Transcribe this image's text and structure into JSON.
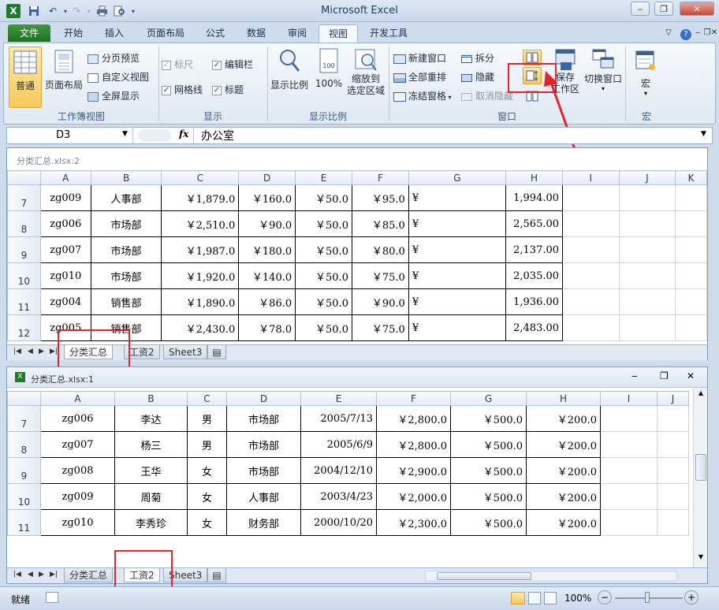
{
  "app": {
    "title": "Microsoft Excel",
    "qat_icons": [
      "excel-logo-icon",
      "save-icon",
      "undo-icon",
      "redo-icon",
      "print-icon",
      "print-preview-icon",
      "customize-icon"
    ]
  },
  "ribbon_tabs": [
    "文件",
    "开始",
    "插入",
    "页面布局",
    "公式",
    "数据",
    "审阅",
    "视图",
    "开发工具"
  ],
  "active_tab": "视图",
  "ribbon": {
    "workbook_views": {
      "label": "工作簿视图",
      "normal": "普通",
      "page_layout": "页面布局",
      "page_break": "分页预览",
      "custom_views": "自定义视图",
      "full_screen": "全屏显示"
    },
    "show": {
      "label": "显示",
      "ruler": "标尺",
      "formula_bar": "编辑栏",
      "gridlines": "网格线",
      "headings": "标题"
    },
    "zoom": {
      "label": "显示比例",
      "zoom": "显示比例",
      "hundred": "100%",
      "zoom_selection_1": "缩放到",
      "zoom_selection_2": "选定区域"
    },
    "window": {
      "label": "窗口",
      "new_window": "新建窗口",
      "arrange_all": "全部重排",
      "freeze": "冻结窗格",
      "split": "拆分",
      "hide": "隐藏",
      "unhide": "取消隐藏",
      "save_workspace_1": "保存",
      "save_workspace_2": "工作区",
      "switch_windows": "切换窗口"
    },
    "macros": {
      "label": "宏",
      "macros": "宏"
    }
  },
  "formula_bar": {
    "name_box": "D3",
    "fx": "fx",
    "value": "办公室"
  },
  "window2": {
    "title": "分类汇总.xlsx:2",
    "columns": [
      "A",
      "B",
      "C",
      "D",
      "E",
      "F",
      "G",
      "H",
      "I",
      "J",
      "K"
    ],
    "rows": [
      {
        "n": "7",
        "cells": [
          "zg009",
          "人事部",
          "￥1,879.0",
          "￥160.0",
          "￥50.0",
          "￥95.0",
          "¥",
          "1,994.00"
        ]
      },
      {
        "n": "8",
        "cells": [
          "zg006",
          "市场部",
          "￥2,510.0",
          "￥90.0",
          "￥50.0",
          "￥85.0",
          "¥",
          "2,565.00"
        ]
      },
      {
        "n": "9",
        "cells": [
          "zg007",
          "市场部",
          "￥1,987.0",
          "￥180.0",
          "￥50.0",
          "￥80.0",
          "¥",
          "2,137.00"
        ]
      },
      {
        "n": "10",
        "cells": [
          "zg010",
          "市场部",
          "￥1,920.0",
          "￥140.0",
          "￥50.0",
          "￥75.0",
          "¥",
          "2,035.00"
        ]
      },
      {
        "n": "11",
        "cells": [
          "zg004",
          "销售部",
          "￥1,890.0",
          "￥86.0",
          "￥50.0",
          "￥90.0",
          "¥",
          "1,936.00"
        ]
      },
      {
        "n": "12",
        "cells": [
          "zg005",
          "销售部",
          "￥2,430.0",
          "￥78.0",
          "￥50.0",
          "￥75.0",
          "¥",
          "2,483.00"
        ]
      }
    ],
    "sheets": [
      "分类汇总",
      "工资2",
      "Sheet3"
    ],
    "active_sheet": "分类汇总"
  },
  "window1": {
    "title": "分类汇总.xlsx:1",
    "columns": [
      "A",
      "B",
      "C",
      "D",
      "E",
      "F",
      "G",
      "H",
      "I",
      "J"
    ],
    "rows": [
      {
        "n": "7",
        "cells": [
          "zg006",
          "李达",
          "男",
          "市场部",
          "2005/7/13",
          "￥2,800.0",
          "￥500.0",
          "￥200.0"
        ]
      },
      {
        "n": "8",
        "cells": [
          "zg007",
          "杨三",
          "男",
          "市场部",
          "2005/6/9",
          "￥2,800.0",
          "￥500.0",
          "￥200.0"
        ]
      },
      {
        "n": "9",
        "cells": [
          "zg008",
          "王华",
          "女",
          "市场部",
          "2004/12/10",
          "￥2,900.0",
          "￥500.0",
          "￥200.0"
        ]
      },
      {
        "n": "10",
        "cells": [
          "zg009",
          "周菊",
          "女",
          "人事部",
          "2003/4/23",
          "￥2,000.0",
          "￥500.0",
          "￥200.0"
        ]
      },
      {
        "n": "11",
        "cells": [
          "zg010",
          "李秀珍",
          "女",
          "财务部",
          "2000/10/20",
          "￥2,300.0",
          "￥500.0",
          "￥200.0"
        ]
      }
    ],
    "sheets": [
      "分类汇总",
      "工资2",
      "Sheet3"
    ],
    "active_sheet": "工资2"
  },
  "status": {
    "ready": "就绪",
    "zoom": "100%",
    "minus": "−",
    "plus": "+"
  },
  "colors": {
    "highlight": "#e3252b",
    "file_tab": "#2a7f2e",
    "ribbon_bg": "#dfe8f3"
  }
}
